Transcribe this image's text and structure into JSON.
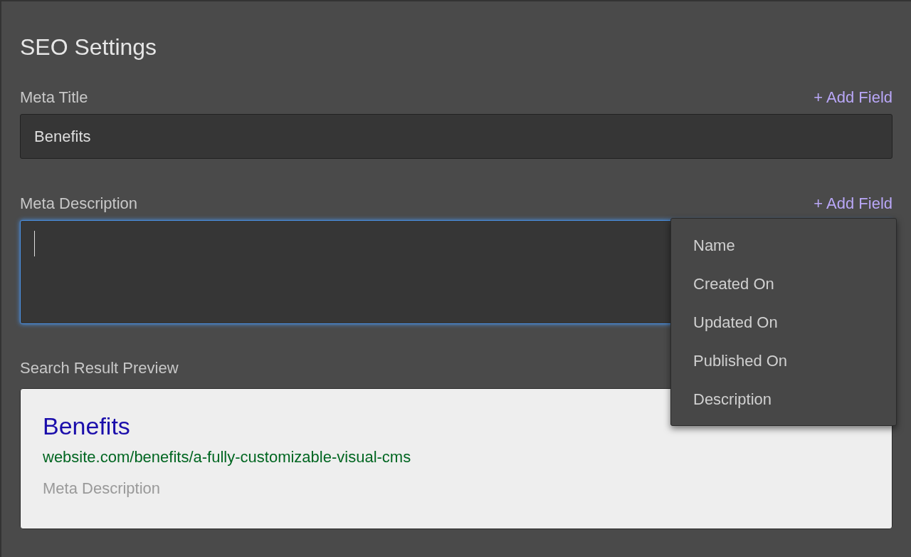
{
  "title": "SEO Settings",
  "fields": [
    {
      "kind": "input",
      "label": "Meta Title",
      "add_field": "+ Add Field",
      "value": "Benefits",
      "focused": false
    },
    {
      "kind": "textarea",
      "label": "Meta Description",
      "add_field": "+ Add Field",
      "focused": true,
      "menu": [
        "Name",
        "Created On",
        "Updated On",
        "Published On",
        "Description"
      ]
    }
  ],
  "preview": {
    "label": "Search Result Preview",
    "title": "Benefits",
    "url": "website.com/benefits/a-fully-customizable-visual-cms",
    "description": "Meta Description"
  }
}
